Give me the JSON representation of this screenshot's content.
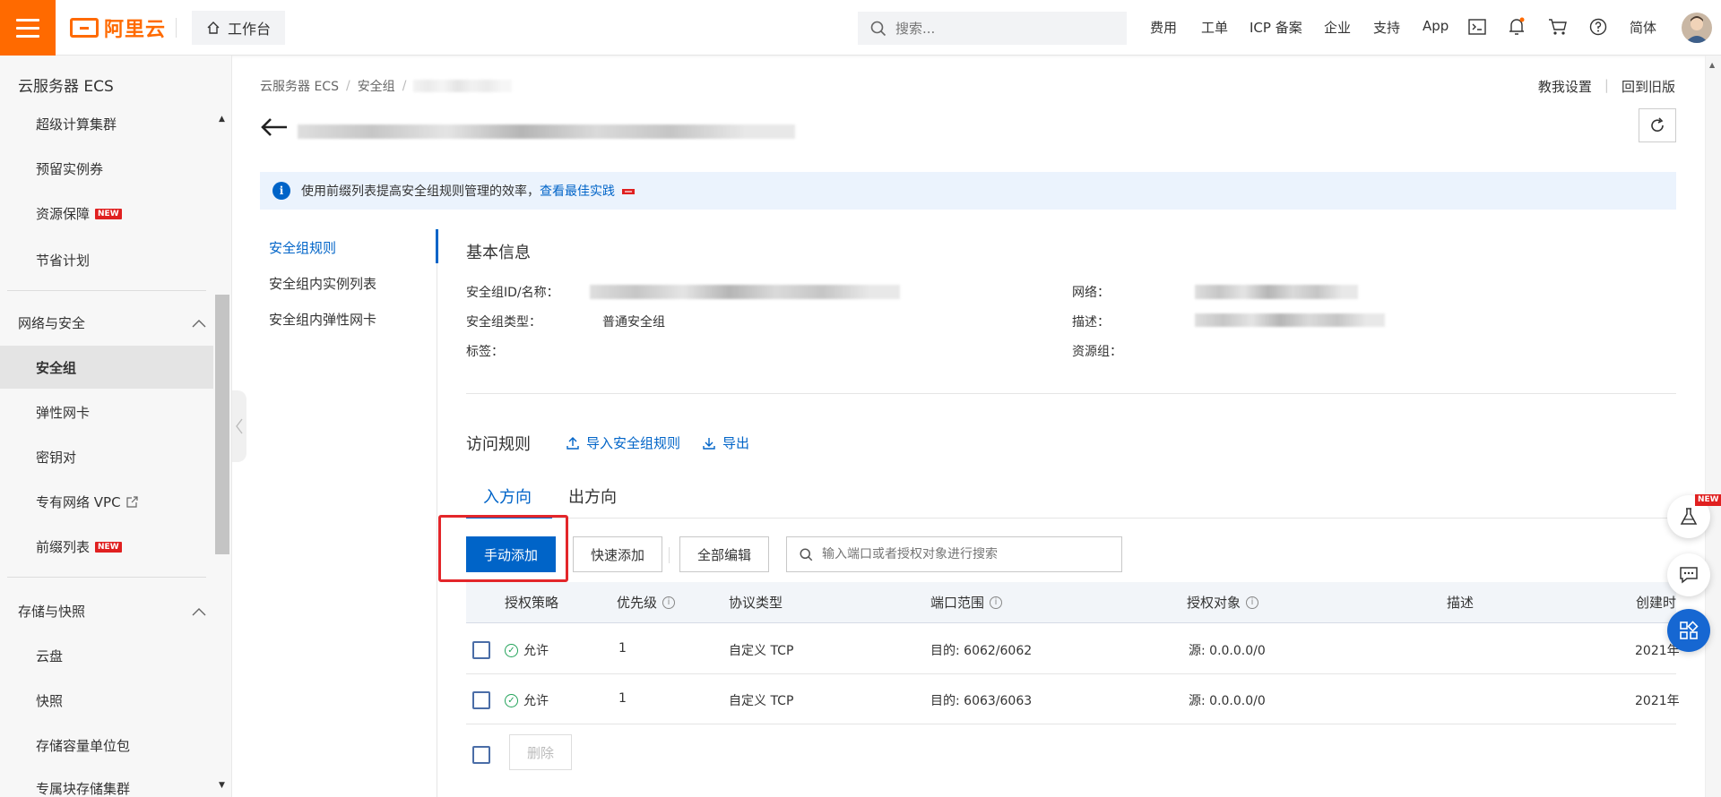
{
  "header": {
    "logo_text": "阿里云",
    "workbench_label": "工作台",
    "search_placeholder": "搜索...",
    "nav": [
      "费用",
      "工单",
      "ICP 备案",
      "企业",
      "支持",
      "App"
    ],
    "lang": "简体",
    "accent_color": "#ff6a00"
  },
  "sidebar": {
    "title": "云服务器 ECS",
    "items_top": [
      {
        "label": "超级计算集群",
        "new": false
      },
      {
        "label": "预留实例券",
        "new": false
      },
      {
        "label": "资源保障",
        "new": true
      },
      {
        "label": "节省计划",
        "new": false
      }
    ],
    "group_network": "网络与安全",
    "items_network": [
      {
        "label": "安全组",
        "active": true
      },
      {
        "label": "弹性网卡"
      },
      {
        "label": "密钥对"
      },
      {
        "label": "专有网络 VPC",
        "external": true
      },
      {
        "label": "前缀列表",
        "new": true
      }
    ],
    "group_storage": "存储与快照",
    "items_storage": [
      "云盘",
      "快照",
      "存储容量单位包",
      "专属块存储集群"
    ],
    "new_badge": "NEW"
  },
  "breadcrumb": {
    "item1": "云服务器 ECS",
    "item2": "安全组"
  },
  "top_links": {
    "teach": "教我设置",
    "back_old": "回到旧版"
  },
  "notice": {
    "text": "使用前缀列表提高安全组规则管理的效率，",
    "link": "查看最佳实践"
  },
  "subnav": [
    "安全组规则",
    "安全组内实例列表",
    "安全组内弹性网卡"
  ],
  "basic_info": {
    "title": "基本信息",
    "id_name_label": "安全组ID/名称：",
    "type_label": "安全组类型：",
    "type_value": "普通安全组",
    "tags_label": "标签：",
    "network_label": "网络：",
    "desc_label": "描述：",
    "resource_group_label": "资源组："
  },
  "access_rules": {
    "title": "访问规则",
    "import_link": "导入安全组规则",
    "export_link": "导出",
    "tabs": [
      "入方向",
      "出方向"
    ],
    "buttons": {
      "manual_add": "手动添加",
      "quick_add": "快速添加",
      "edit_all": "全部编辑"
    },
    "search_placeholder": "输入端口或者授权对象进行搜索",
    "columns": [
      "授权策略",
      "优先级",
      "协议类型",
      "端口范围",
      "授权对象",
      "描述",
      "创建时"
    ],
    "rows": [
      {
        "policy": "允许",
        "priority": "1",
        "protocol": "自定义 TCP",
        "port": "目的: 6062/6062",
        "object": "源: 0.0.0.0/0",
        "desc": "",
        "created": "2021年"
      },
      {
        "policy": "允许",
        "priority": "1",
        "protocol": "自定义 TCP",
        "port": "目的: 6063/6063",
        "object": "源: 0.0.0.0/0",
        "desc": "",
        "created": "2021年"
      }
    ],
    "delete_label": "删除"
  },
  "float_badge": "NEW"
}
